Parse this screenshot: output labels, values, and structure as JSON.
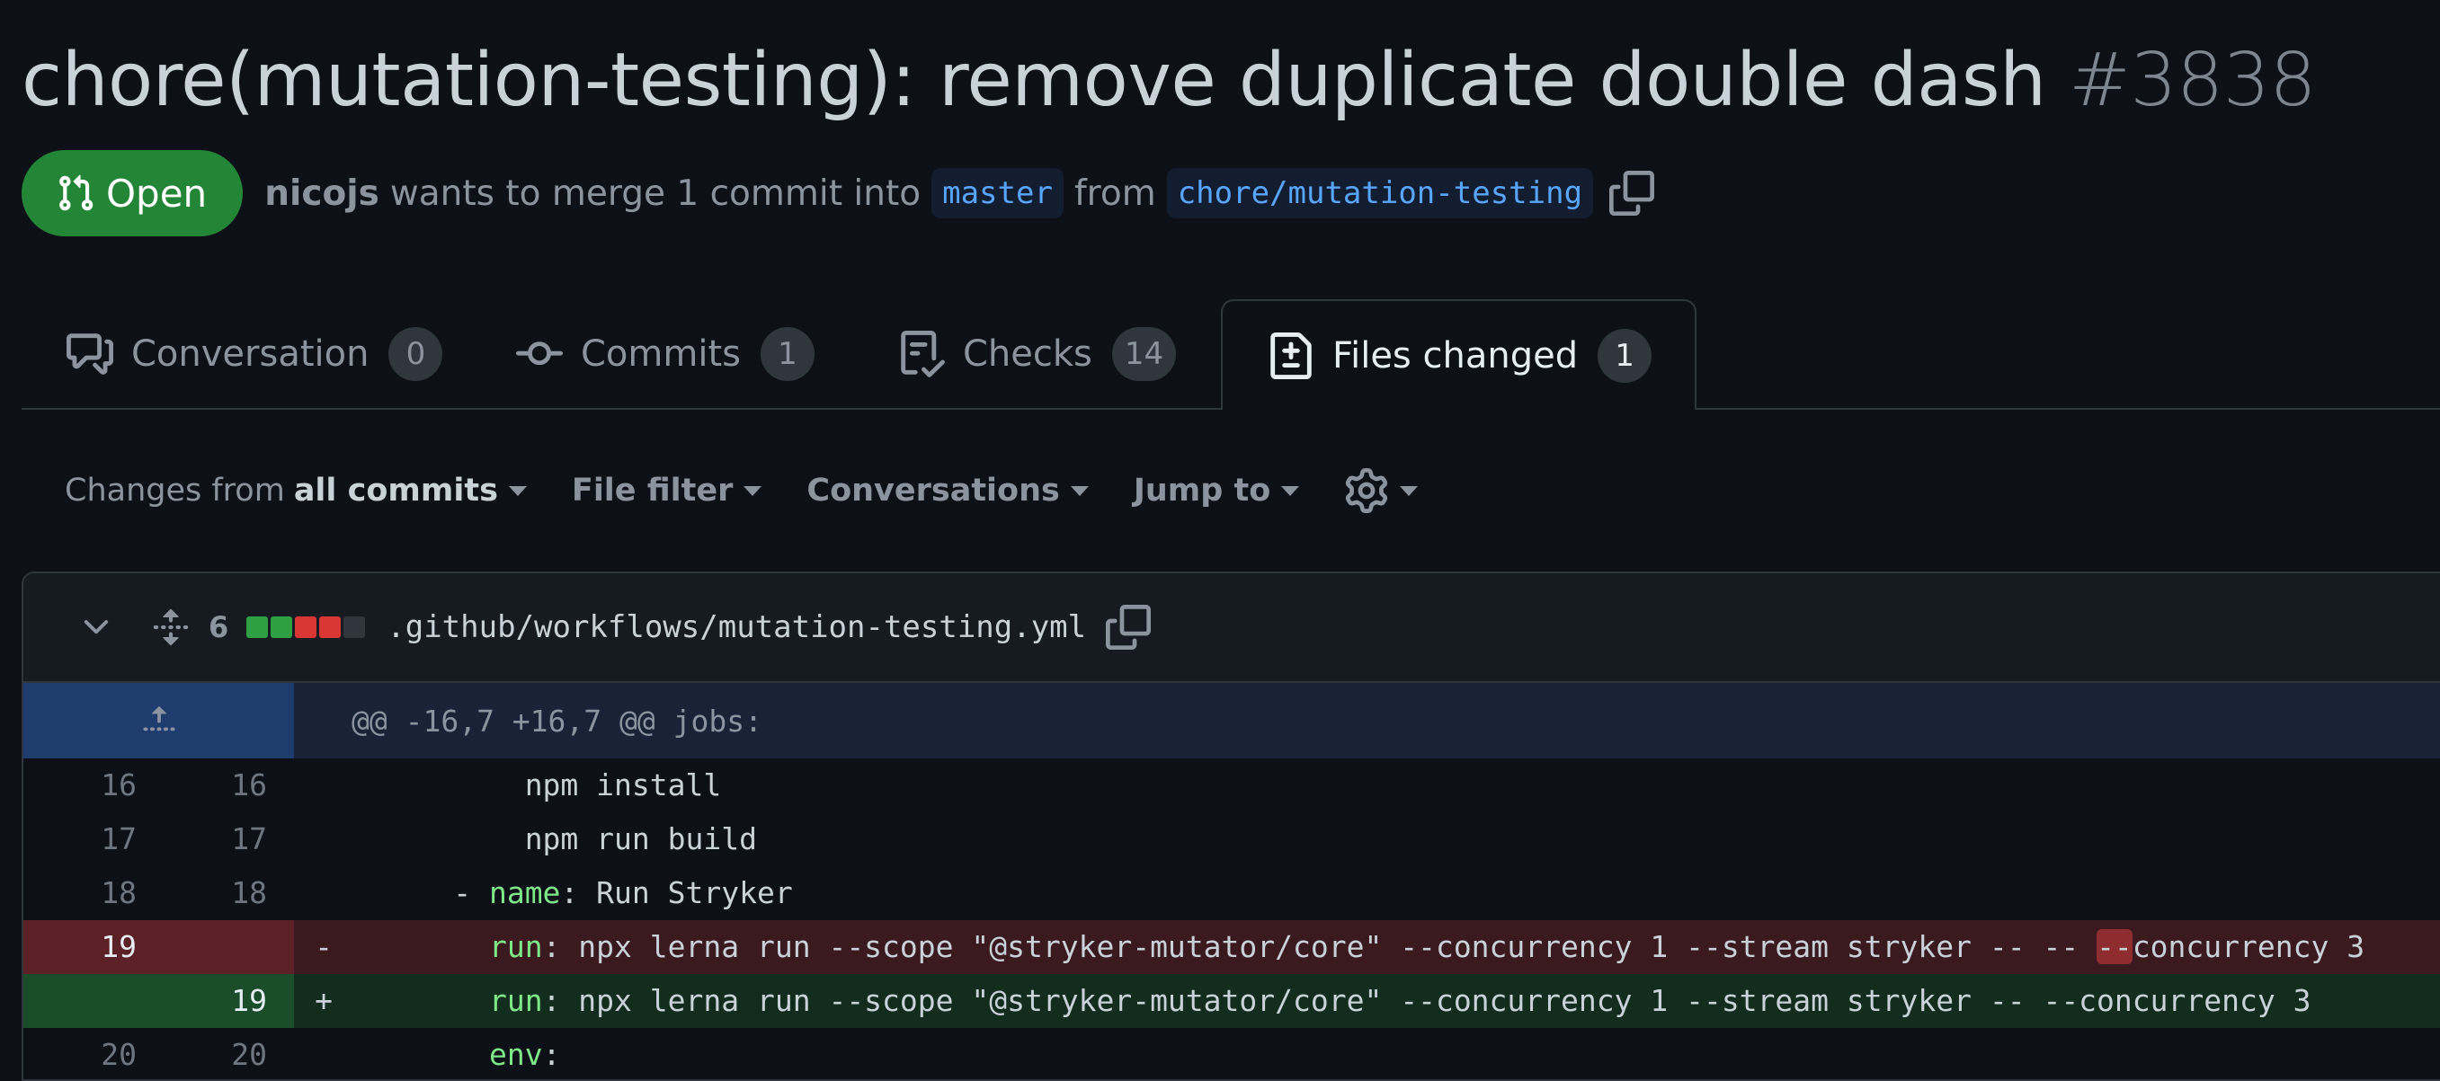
{
  "pr": {
    "title": "chore(mutation-testing): remove duplicate double dash",
    "number": "#3838",
    "state": "Open",
    "author": "nicojs",
    "merge_text": "wants to merge 1 commit into",
    "base_branch": "master",
    "from_text": "from",
    "head_branch": "chore/mutation-testing"
  },
  "tabs": [
    {
      "label": "Conversation",
      "count": "0",
      "icon": "comment-discussion-icon"
    },
    {
      "label": "Commits",
      "count": "1",
      "icon": "git-commit-icon"
    },
    {
      "label": "Checks",
      "count": "14",
      "icon": "checklist-icon"
    },
    {
      "label": "Files changed",
      "count": "1",
      "icon": "file-diff-icon",
      "active": true
    }
  ],
  "toolbar": {
    "changes_from": "Changes from",
    "changes_from_value": "all commits",
    "file_filter": "File filter",
    "conversations": "Conversations",
    "jump_to": "Jump to"
  },
  "file": {
    "change_count": "6",
    "path": ".github/workflows/mutation-testing.yml",
    "diffstat_colors": [
      "#2ea043",
      "#2ea043",
      "#da3633",
      "#da3633",
      "#30363d"
    ],
    "hunk_header": "@@ -16,7 +16,7 @@ jobs:",
    "lines": [
      {
        "old": "16",
        "new": "16",
        "sign": "",
        "indent": "          ",
        "key": "",
        "text": "npm install"
      },
      {
        "old": "17",
        "new": "17",
        "sign": "",
        "indent": "          ",
        "key": "",
        "text": "npm run build"
      },
      {
        "old": "18",
        "new": "18",
        "sign": "",
        "indent": "      - ",
        "key": "name",
        "text": ": Run Stryker"
      },
      {
        "old": "19",
        "new": "",
        "sign": "-",
        "indent": "        ",
        "key": "run",
        "text": ": npx lerna run --scope \"@stryker-mutator/core\" --concurrency 1 --stream stryker -- -- ",
        "highlight": "--",
        "tail": "concurrency 3"
      },
      {
        "old": "",
        "new": "19",
        "sign": "+",
        "indent": "        ",
        "key": "run",
        "text": ": npx lerna run --scope \"@stryker-mutator/core\" --concurrency 1 --stream stryker -- --concurrency 3"
      },
      {
        "old": "20",
        "new": "20",
        "sign": "",
        "indent": "        ",
        "key": "env",
        "text": ":"
      }
    ]
  },
  "colors": {
    "open_badge": "#238636",
    "link": "#58a6ff",
    "yaml_key": "#7ee787"
  }
}
